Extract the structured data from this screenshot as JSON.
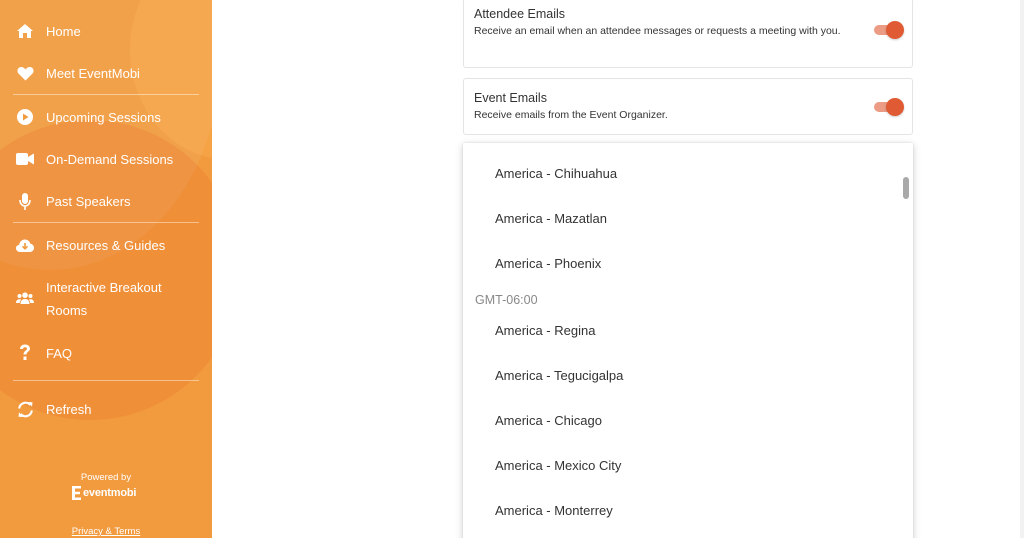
{
  "sidebar": {
    "items": [
      {
        "label": "Home",
        "icon": "home-icon"
      },
      {
        "label": "Meet EventMobi",
        "icon": "heart-icon"
      },
      {
        "label": "Upcoming Sessions",
        "icon": "play-circle-icon"
      },
      {
        "label": "On-Demand Sessions",
        "icon": "video-camera-icon"
      },
      {
        "label": "Past Speakers",
        "icon": "microphone-icon"
      },
      {
        "label": "Resources & Guides",
        "icon": "cloud-download-icon"
      },
      {
        "label": "Interactive Breakout Rooms",
        "icon": "users-icon"
      },
      {
        "label": "FAQ",
        "icon": "question-mark-icon"
      },
      {
        "label": "Refresh",
        "icon": "refresh-icon"
      }
    ],
    "powered_by": "Powered by",
    "brand": "eventmobi",
    "privacy": "Privacy & Terms"
  },
  "settings": {
    "attendee_emails": {
      "title": "Attendee Emails",
      "description": "Receive an email when an attendee messages or requests a meeting with you.",
      "enabled": true
    },
    "event_emails": {
      "title": "Event Emails",
      "description": "Receive emails from the Event Organizer.",
      "enabled": true
    }
  },
  "timezone_dropdown": {
    "options_before": [
      "America - Chihuahua",
      "America - Mazatlan",
      "America - Phoenix"
    ],
    "group": "GMT-06:00",
    "options_after": [
      "America - Regina",
      "America - Tegucigalpa",
      "America - Chicago",
      "America - Mexico City",
      "America - Monterrey"
    ]
  },
  "colors": {
    "sidebar": "#f29a3e",
    "toggle_on": "#e05a33",
    "toggle_track": "#ec9c85"
  }
}
